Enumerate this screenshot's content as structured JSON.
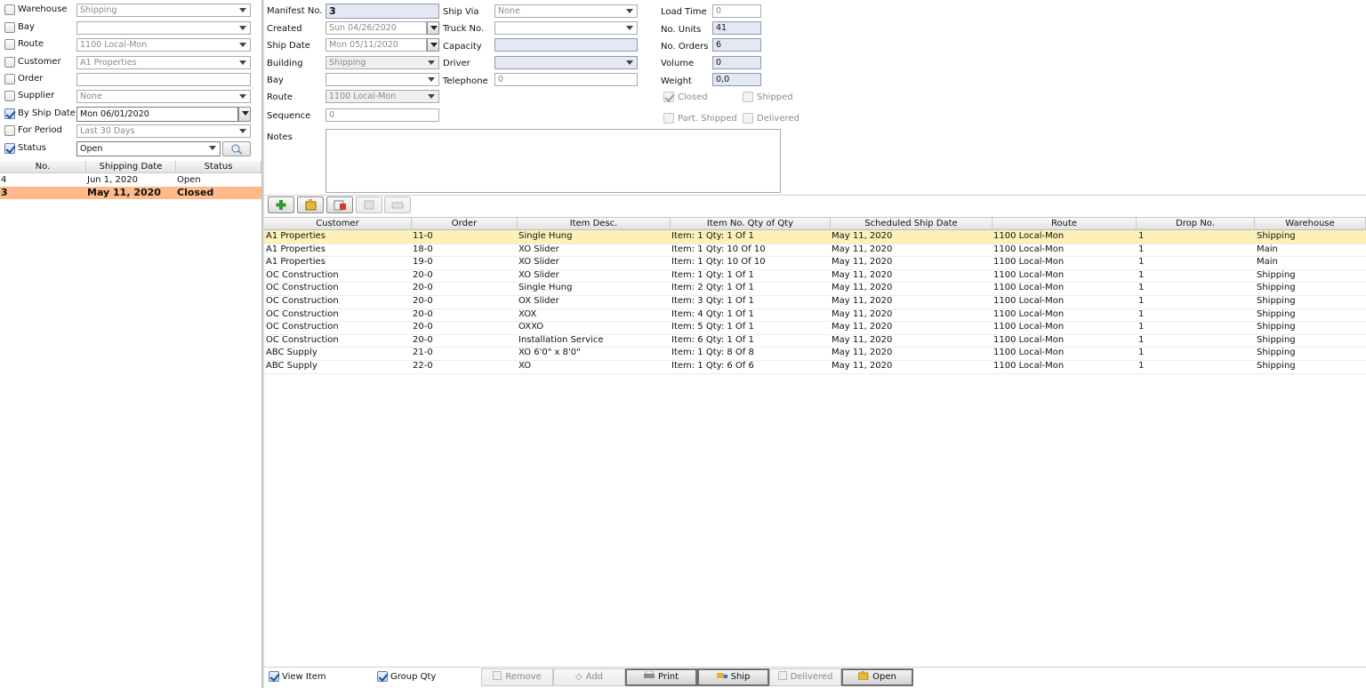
{
  "filters": {
    "warehouse": {
      "label": "Warehouse",
      "value": "Shipping"
    },
    "bay": {
      "label": "Bay",
      "value": ""
    },
    "route": {
      "label": "Route",
      "value": "1100 Local-Mon"
    },
    "customer": {
      "label": "Customer",
      "value": "A1 Properties"
    },
    "order": {
      "label": "Order",
      "value": ""
    },
    "supplier": {
      "label": "Supplier",
      "value": "None"
    },
    "by_ship_date": {
      "label": "By Ship Date",
      "value": "Mon 06/01/2020"
    },
    "for_period": {
      "label": "For Period",
      "value": "Last 30 Days"
    },
    "status": {
      "label": "Status",
      "value": "Open"
    }
  },
  "manifest_list": {
    "headers": [
      "No.",
      "Shipping Date",
      "Status"
    ],
    "rows": [
      {
        "no": "4",
        "date": "Jun 1, 2020",
        "status": "Open"
      },
      {
        "no": "3",
        "date": "May 11, 2020",
        "status": "Closed"
      }
    ]
  },
  "form": {
    "manifest_no": {
      "label": "Manifest No.",
      "value": "3"
    },
    "created": {
      "label": "Created",
      "value": "Sun 04/26/2020"
    },
    "ship_date": {
      "label": "Ship Date",
      "value": "Mon 05/11/2020"
    },
    "building": {
      "label": "Building",
      "value": "Shipping"
    },
    "bay": {
      "label": "Bay",
      "value": ""
    },
    "route": {
      "label": "Route",
      "value": "1100 Local-Mon"
    },
    "sequence": {
      "label": "Sequence",
      "value": "0"
    },
    "notes": {
      "label": "Notes",
      "value": ""
    },
    "ship_via": {
      "label": "Ship Via",
      "value": "None"
    },
    "truck_no": {
      "label": "Truck No.",
      "value": ""
    },
    "capacity": {
      "label": "Capacity",
      "value": ""
    },
    "driver": {
      "label": "Driver",
      "value": ""
    },
    "telephone": {
      "label": "Telephone",
      "value": "0"
    },
    "load_time": {
      "label": "Load Time",
      "value": "0"
    },
    "no_units": {
      "label": "No. Units",
      "value": "41"
    },
    "no_orders": {
      "label": "No. Orders",
      "value": "6"
    },
    "volume": {
      "label": "Volume",
      "value": "0"
    },
    "weight": {
      "label": "Weight",
      "value": "0,0"
    },
    "closed": "Closed",
    "shipped": "Shipped",
    "part_shipped": "Part. Shipped",
    "delivered": "Delivered"
  },
  "grid": {
    "headers": [
      "Customer",
      "Order",
      "Item Desc.",
      "Item No. Qty of Qty",
      "Scheduled Ship Date",
      "Route",
      "Drop No.",
      "Warehouse"
    ],
    "rows": [
      [
        "A1 Properties",
        "11-0",
        "Single Hung",
        "Item: 1 Qty: 1 Of 1",
        "May 11, 2020",
        "1100 Local-Mon",
        "1",
        "Shipping"
      ],
      [
        "A1 Properties",
        "18-0",
        "XO Slider",
        "Item: 1 Qty: 10 Of 10",
        "May 11, 2020",
        "1100 Local-Mon",
        "1",
        "Main"
      ],
      [
        "A1 Properties",
        "19-0",
        "XO Slider",
        "Item: 1 Qty: 10 Of 10",
        "May 11, 2020",
        "1100 Local-Mon",
        "1",
        "Main"
      ],
      [
        "OC Construction",
        "20-0",
        "XO Slider",
        "Item: 1 Qty: 1 Of 1",
        "May 11, 2020",
        "1100 Local-Mon",
        "1",
        "Shipping"
      ],
      [
        "OC Construction",
        "20-0",
        "Single Hung",
        "Item: 2 Qty: 1 Of 1",
        "May 11, 2020",
        "1100 Local-Mon",
        "1",
        "Shipping"
      ],
      [
        "OC Construction",
        "20-0",
        "OX Slider",
        "Item: 3 Qty: 1 Of 1",
        "May 11, 2020",
        "1100 Local-Mon",
        "1",
        "Shipping"
      ],
      [
        "OC Construction",
        "20-0",
        "XOX",
        "Item: 4 Qty: 1 Of 1",
        "May 11, 2020",
        "1100 Local-Mon",
        "1",
        "Shipping"
      ],
      [
        "OC Construction",
        "20-0",
        "OXXO",
        "Item: 5 Qty: 1 Of 1",
        "May 11, 2020",
        "1100 Local-Mon",
        "1",
        "Shipping"
      ],
      [
        "OC Construction",
        "20-0",
        "Installation Service",
        "Item: 6 Qty: 1 Of 1",
        "May 11, 2020",
        "1100 Local-Mon",
        "1",
        "Shipping"
      ],
      [
        "ABC Supply",
        "21-0",
        "XO 6'0\" x 8'0\"",
        "Item: 1 Qty: 8 Of 8",
        "May 11, 2020",
        "1100 Local-Mon",
        "1",
        "Shipping"
      ],
      [
        "ABC Supply",
        "22-0",
        "XO",
        "Item: 1 Qty: 6 Of 6",
        "May 11, 2020",
        "1100 Local-Mon",
        "1",
        "Shipping"
      ]
    ]
  },
  "bottom": {
    "view_item": "View Item",
    "group_qty": "Group Qty",
    "remove": "Remove",
    "add": "Add",
    "print": "Print",
    "ship": "Ship",
    "delivered": "Delivered",
    "open": "Open"
  }
}
